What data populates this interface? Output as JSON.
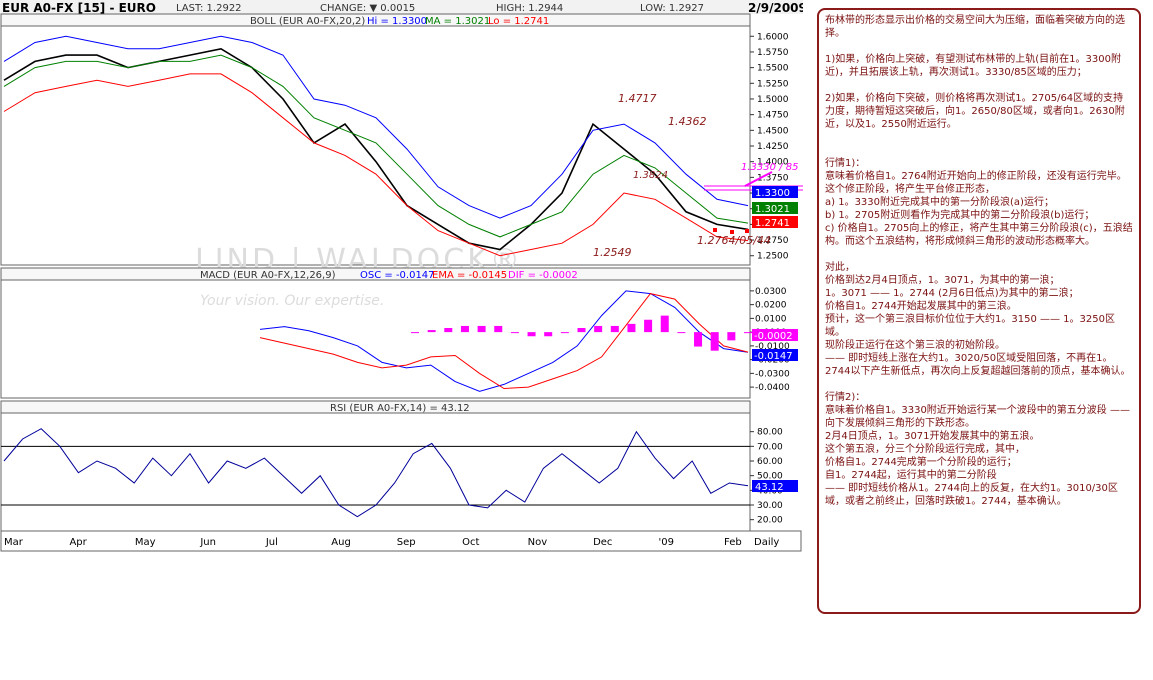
{
  "header": {
    "symbol": "EUR A0-FX [15] - EURO",
    "last": "LAST: 1.2922",
    "change": "CHANGE: ▼ 0.0015",
    "high": "HIGH: 1.2944",
    "low": "LOW: 1.2927",
    "date": "2/9/2009"
  },
  "boll_legend": {
    "name": "BOLL (EUR A0-FX,20,2)",
    "hi": "Hi = 1.3300",
    "ma": "MA = 1.3021",
    "lo": "Lo = 1.2741"
  },
  "macd_legend": {
    "name": "MACD (EUR A0-FX,12,26,9)",
    "osc": "OSC = -0.0147",
    "ema": "EMA = -0.0145",
    "dif": "DIF = -0.0002"
  },
  "rsi_legend": {
    "name": "RSI (EUR A0-FX,14) = 43.12"
  },
  "watermark": {
    "logo": "LIND | WALDOCK®",
    "slogan": "Your vision. Our expertise."
  },
  "colors": {
    "price": "#000000",
    "boll_hi": "#0000ff",
    "boll_ma": "#008000",
    "boll_lo": "#ff0000",
    "macd_osc": "#0000ff",
    "macd_ema": "#ff0000",
    "macd_dif": "#ff00ff",
    "rsi": "#000099",
    "annotation": "#8b1a1a",
    "annotation_pink": "#ff00ff"
  },
  "price_axis": [
    "1.6000",
    "1.5750",
    "1.5500",
    "1.5250",
    "1.5000",
    "1.4750",
    "1.4500",
    "1.4250",
    "1.4000",
    "1.3750",
    "1.3500",
    "1.3250",
    "1.3000",
    "1.2750",
    "1.2500"
  ],
  "macd_axis": [
    "0.0300",
    "0.0200",
    "0.0100",
    "0.0000",
    "-0.0100",
    "-0.0200",
    "-0.0300",
    "-0.0400"
  ],
  "rsi_axis": [
    "80.00",
    "70.00",
    "60.00",
    "50.00",
    "40.00",
    "30.00",
    "20.00"
  ],
  "time_axis": [
    "Mar",
    "Apr",
    "May",
    "Jun",
    "Jul",
    "Aug",
    "Sep",
    "Oct",
    "Nov",
    "Dec",
    "'09",
    "Feb",
    "Daily"
  ],
  "value_tags": {
    "hi": "1.3300",
    "ma": "1.3021",
    "lo": "1.2741",
    "dif": "-0.0002",
    "osc": "-0.0147",
    "rsi": "43.12"
  },
  "annotations": {
    "a1": "1.4717",
    "a2": "1.4362",
    "a3": "1.3824",
    "a4": "1.2549",
    "a5": "1.2764/05/44",
    "a6": "1.3330 / 85"
  },
  "chart_data": {
    "type": "line",
    "title": "EUR A0-FX [15] - EURO",
    "period": "Daily",
    "x": [
      "Mar",
      "Apr",
      "May",
      "Jun",
      "Jul",
      "Aug",
      "Sep",
      "Oct",
      "Nov",
      "Dec",
      "'09",
      "Feb"
    ],
    "ylim_price": [
      1.24,
      1.61
    ],
    "series": [
      {
        "name": "EUR A0-FX",
        "values": [
          1.53,
          1.56,
          1.57,
          1.57,
          1.55,
          1.56,
          1.57,
          1.58,
          1.55,
          1.5,
          1.43,
          1.46,
          1.4,
          1.33,
          1.3,
          1.27,
          1.26,
          1.3,
          1.35,
          1.46,
          1.42,
          1.38,
          1.32,
          1.3,
          1.292
        ]
      },
      {
        "name": "Hi",
        "values": [
          1.56,
          1.59,
          1.6,
          1.59,
          1.58,
          1.58,
          1.59,
          1.6,
          1.59,
          1.57,
          1.5,
          1.49,
          1.47,
          1.42,
          1.36,
          1.33,
          1.31,
          1.33,
          1.38,
          1.45,
          1.46,
          1.43,
          1.38,
          1.34,
          1.33
        ]
      },
      {
        "name": "MA",
        "values": [
          1.52,
          1.55,
          1.56,
          1.56,
          1.55,
          1.56,
          1.56,
          1.57,
          1.55,
          1.52,
          1.47,
          1.45,
          1.43,
          1.38,
          1.33,
          1.3,
          1.28,
          1.3,
          1.32,
          1.38,
          1.41,
          1.39,
          1.35,
          1.31,
          1.3021
        ]
      },
      {
        "name": "Lo",
        "values": [
          1.48,
          1.51,
          1.52,
          1.53,
          1.52,
          1.53,
          1.54,
          1.54,
          1.51,
          1.47,
          1.43,
          1.41,
          1.38,
          1.33,
          1.29,
          1.27,
          1.25,
          1.26,
          1.27,
          1.3,
          1.35,
          1.34,
          1.31,
          1.28,
          1.2741
        ]
      }
    ],
    "macd": {
      "ylim": [
        -0.045,
        0.035
      ],
      "OSC": [
        0.002,
        0.004,
        0.001,
        -0.004,
        -0.01,
        -0.022,
        -0.026,
        -0.024,
        -0.036,
        -0.043,
        -0.038,
        -0.03,
        -0.022,
        -0.01,
        0.012,
        0.03,
        0.028,
        0.018,
        0.0,
        -0.012,
        -0.0147
      ],
      "EMA": [
        -0.004,
        -0.008,
        -0.012,
        -0.016,
        -0.022,
        -0.026,
        -0.024,
        -0.018,
        -0.017,
        -0.03,
        -0.041,
        -0.04,
        -0.034,
        -0.028,
        -0.018,
        0.005,
        0.028,
        0.024,
        0.006,
        -0.01,
        -0.0145
      ],
      "DIF": [
        0.0,
        0.001,
        0.002,
        0.003,
        0.003,
        0.003,
        0.0,
        -0.002,
        -0.002,
        0.0,
        0.002,
        0.003,
        0.003,
        0.004,
        0.006,
        0.008,
        0.0,
        -0.007,
        -0.009,
        -0.004,
        -0.0002
      ]
    },
    "rsi": {
      "ylim": [
        15,
        90
      ],
      "levels": [
        70,
        30
      ],
      "values": [
        60,
        75,
        82,
        70,
        52,
        60,
        55,
        45,
        62,
        50,
        65,
        45,
        60,
        55,
        62,
        50,
        38,
        50,
        30,
        22,
        30,
        45,
        65,
        72,
        55,
        30,
        28,
        40,
        32,
        55,
        65,
        55,
        45,
        55,
        80,
        62,
        48,
        60,
        38,
        45,
        43.12
      ]
    }
  },
  "notes": [
    "布林带的形态显示出价格的交易空间大为压缩，面临着突破方向的选择。",
    "",
    "1)如果，价格向上突破，有望测试布林带的上轨(目前在1。3300附近)，并且拓展该上轨，再次测试1。3330/85区域的压力；",
    "",
    "2)如果，价格向下突破，则价格将再次测试1。2705/64区域的支持力度，期待暂短这突破后，向1。2650/80区域，或者向1。2630附近，以及1。2550附近运行。",
    "",
    "",
    "行情1)：",
    "意味着价格自1。2764附近开始向上的修正阶段，还没有运行完毕。",
    "这个修正阶段，将产生平台修正形态，",
    "a) 1。3330附近完成其中的第一分阶段浪(a)运行；",
    "b) 1。2705附近则看作为完成其中的第二分阶段浪(b)运行；",
    "c) 价格自1。2705向上的修正，将产生其中第三分阶段浪(c)，五浪结构。而这个五浪结构，将形成倾斜三角形的波动形态概率大。",
    "",
    "对此，",
    "价格到达2月4日顶点，1。3071，为其中的第一浪；",
    "1。3071 —— 1。2744 (2月6日低点)为其中的第二浪；",
    "价格自1。2744开始起发展其中的第三浪。",
    "预计，这一个第三浪目标价位位于大约1。3150 —— 1。3250区域。",
    "现阶段正运行在这个第三浪的初始阶段。",
    "—— 即时短线上涨在大约1。3020/50区域受阻回落，不再在1。2744以下产生新低点，再次向上反复超越回落前的顶点，基本确认。",
    "",
    "行情2)：",
    "意味着价格自1。3330附近开始运行某一个波段中的第五分波段 —— 向下发展倾斜三角形的下跌形态。",
    "2月4日顶点，1。3071开始发展其中的第五浪。",
    "这个第五浪，分三个分阶段运行完成，其中，",
    "价格自1。2744完成第一个分阶段的运行；",
    "自1。2744起，运行其中的第二分阶段",
    "—— 即时短线价格从1。2744向上的反复，在大约1。3010/30区域，或者之前终止，回落时跌破1。2744，基本确认。"
  ]
}
